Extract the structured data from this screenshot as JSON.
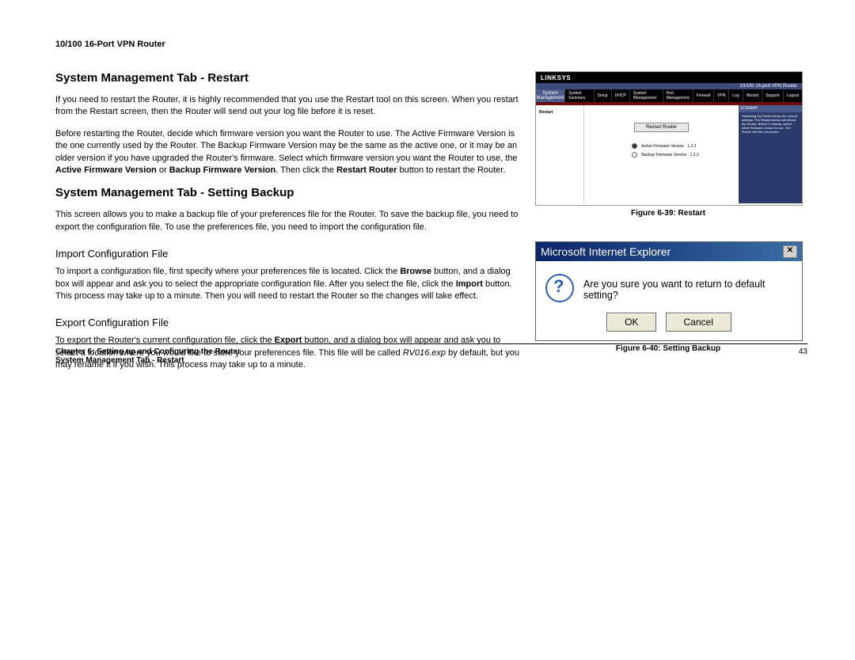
{
  "header": {
    "title": "10/100 16-Port VPN Router"
  },
  "section1": {
    "heading": "System Management Tab - Restart",
    "p1": "If you need to restart the Router, it is highly recommended that you use the Restart tool on this screen. When you restart from the Restart screen, then the Router will send out your log file before it is reset.",
    "p2_a": "Before restarting the Router, decide which firmware version you want the Router to use. The Active Firmware Version is the one currently used by the Router. The Backup Firmware Version may be the same as the active one, or it may be an older version if you have upgraded the Router's firmware. Select which firmware version you want the Router to use, the ",
    "p2_b1": "Active Firmware Version",
    "p2_c": " or ",
    "p2_b2": "Backup Firmware Version",
    "p2_d": ". Then click the ",
    "p2_b3": "Restart Router",
    "p2_e": " button to restart the Router."
  },
  "section2": {
    "heading": "System Management Tab - Setting Backup",
    "p1": "This screen allows you to make a backup file of your preferences file for the Router. To save the backup file, you need to export the configuration file. To use the preferences file, you need to import the configuration file."
  },
  "import": {
    "heading": "Import Configuration File",
    "p_a": "To import a configuration file, first specify where your preferences file is located. Click the ",
    "p_b1": "Browse",
    "p_c": " button, and a dialog box will appear and ask you to select the appropriate configuration file. After you select the file, click the ",
    "p_b2": "Import",
    "p_d": " button. This process may take up to a minute. Then you will need to restart the Router so the changes will take effect."
  },
  "export": {
    "heading": "Export Configuration File",
    "p_a": "To export the Router's current configuration file, click the ",
    "p_b1": "Export",
    "p_c": " button, and a dialog box will appear and ask you to select a location where you would like to store your preferences file. This file will be called ",
    "p_i": "RV016.exp",
    "p_d": " by default, but you may rename it if you wish. This process may take up to a minute."
  },
  "fig39": {
    "caption": "Figure 6-39: Restart",
    "brand": "LINKSYS",
    "desc": "10/100 16-port VPN Router",
    "bigtab1": "System",
    "bigtab2": "Management",
    "tabs": [
      "System Summary",
      "Setup",
      "DHCP",
      "System Management",
      "Port Management",
      "Firewall",
      "VPN",
      "Log",
      "Wizard",
      "Support",
      "Logout"
    ],
    "leftlabel": "Restart",
    "btn": "Restart Router",
    "opt1": "Active Firmware Version",
    "opt1v": "1.2.3",
    "opt2": "Backup Firmware Version",
    "opt2v": "1.2.3",
    "sitemap": "SITEMAP"
  },
  "fig40": {
    "caption": "Figure 6-40: Setting Backup",
    "title": "Microsoft Internet Explorer",
    "msg": "Are you sure you want to return to default setting?",
    "ok": "OK",
    "cancel": "Cancel"
  },
  "footer": {
    "line1": "Chapter 6: Setting up and Configuring the Router",
    "line2": "System Management Tab - Restart",
    "page": "43"
  }
}
